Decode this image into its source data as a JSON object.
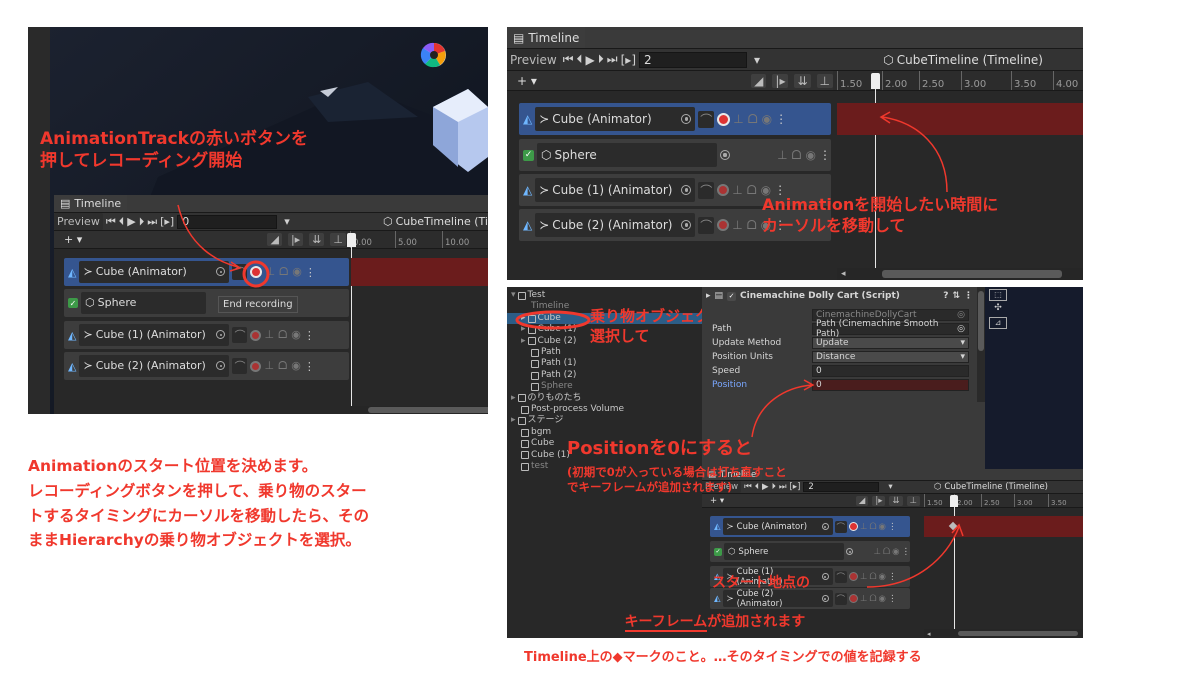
{
  "annotations": {
    "record_button_note": "AnimationTrackの赤いボタンを\n押してレコーディング開始",
    "move_cursor_note": "Animationを開始したい時間に\nカーソルを移動して",
    "select_object_note": "乗り物オブジェクトを\n選択して",
    "position_zero_title": "Positionを0にすると",
    "position_zero_sub": "(初期で0が入っている場合は打ち直すこと\nでキーフレームが追加されます)",
    "start_point_note": "スタート地点の",
    "keyframe_word": "キーフレーム",
    "keyframe_rest": "が追加されます",
    "left_description": "Animationのスタート位置を決めます。\nレコーディングボタンを押して、乗り物のスター\nトするタイミングにカーソルを移動したら、その\nままHierarchyの乗り物オブジェクトを選択。",
    "footer_note": "Timeline上の◆マークのこと。…そのタイミングでの値を記録する"
  },
  "timeline": {
    "tab_title": "Timeline",
    "preview_label": "Preview",
    "asset_name": "CubeTimeline (Timeline)",
    "asset_name_cut": "CubeTimeline (Ti",
    "frame_left": "0",
    "frame_right": "2",
    "frame_bottom": "2",
    "tooltip": "End recording",
    "tracks": [
      "Cube (Animator)",
      "Sphere",
      "Cube (1) (Animator)",
      "Cube (2) (Animator)"
    ],
    "ticks_left": [
      "0.00",
      "5.00",
      "10.00"
    ],
    "ticks_right": [
      "1.50",
      "2.00",
      "2.50",
      "3.00",
      "3.50",
      "4.00"
    ],
    "ticks_bottom": [
      "1.50",
      "2.00",
      "2.50",
      "3.00",
      "3.50"
    ],
    "controls": [
      "⏮",
      "⏴",
      "▶",
      "⏵",
      "⏭",
      "[▸]"
    ]
  },
  "hierarchy": {
    "items": [
      {
        "label": "Test",
        "indent": 0
      },
      {
        "label": "Timeline",
        "indent": 1
      },
      {
        "label": "Cube",
        "indent": 1
      },
      {
        "label": "Cube (1)",
        "indent": 1
      },
      {
        "label": "Cube (2)",
        "indent": 1
      },
      {
        "label": "Path",
        "indent": 1
      },
      {
        "label": "Path (1)",
        "indent": 1
      },
      {
        "label": "Path (2)",
        "indent": 1
      },
      {
        "label": "Sphere",
        "indent": 1
      },
      {
        "label": "のりものたち",
        "indent": 0
      },
      {
        "label": "Post-process Volume",
        "indent": 0
      },
      {
        "label": "ステージ",
        "indent": 0
      },
      {
        "label": "bgm",
        "indent": 0
      },
      {
        "label": "Cube",
        "indent": 0
      },
      {
        "label": "Cube (1)",
        "indent": 0
      },
      {
        "label": "test",
        "indent": 0
      }
    ]
  },
  "inspector": {
    "component": "Cinemachine Dolly Cart (Script)",
    "script_value": "CinemachineDollyCart",
    "path_label": "Path",
    "path_value": "Path (Cinemachine Smooth Path)",
    "update_label": "Update Method",
    "update_value": "Update",
    "units_label": "Position Units",
    "units_value": "Distance",
    "speed_label": "Speed",
    "speed_value": "0",
    "position_label": "Position",
    "position_value": "0"
  },
  "colors": {
    "annotation": "#f0382d",
    "recording_clip": "#6b1c1c",
    "selected_track": "#35558f",
    "record": "#d33333"
  }
}
